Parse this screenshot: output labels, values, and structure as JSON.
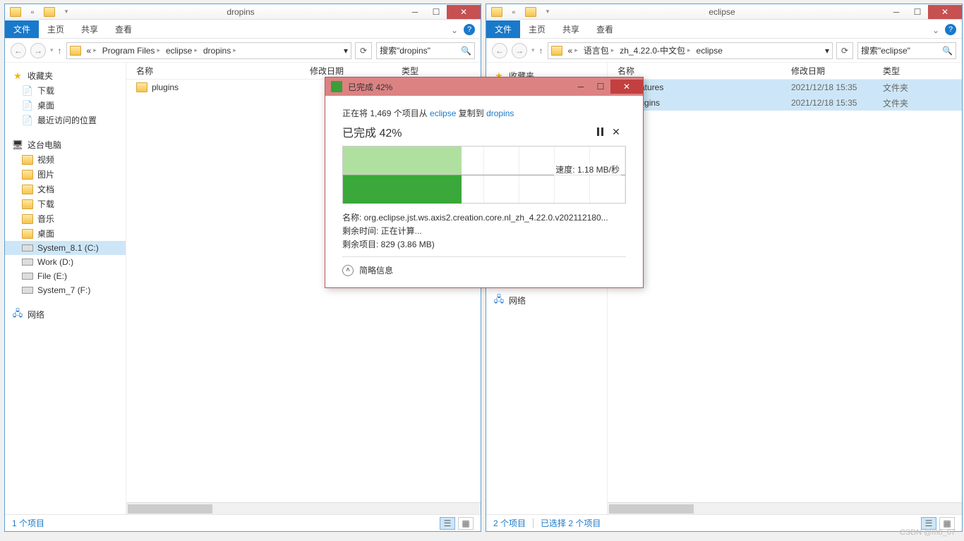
{
  "left": {
    "title": "dropins",
    "ribbon": {
      "file": "文件",
      "home": "主页",
      "share": "共享",
      "view": "查看"
    },
    "breadcrumbs": [
      "Program Files",
      "eclipse",
      "dropins"
    ],
    "search_placeholder": "搜索\"dropins\"",
    "columns": {
      "name": "名称",
      "date": "修改日期",
      "type": "类型"
    },
    "files": [
      {
        "name": "plugins",
        "date": "",
        "type": ""
      }
    ],
    "status": "1 个项目"
  },
  "right": {
    "title": "eclipse",
    "ribbon": {
      "file": "文件",
      "home": "主页",
      "share": "共享",
      "view": "查看"
    },
    "breadcrumbs": [
      "语言包",
      "zh_4.22.0-中文包",
      "eclipse"
    ],
    "search_placeholder": "搜索\"eclipse\"",
    "columns": {
      "name": "名称",
      "date": "修改日期",
      "type": "类型"
    },
    "files": [
      {
        "name": "features",
        "date": "2021/12/18 15:35",
        "type": "文件夹"
      },
      {
        "name": "plugins",
        "date": "2021/12/18 15:35",
        "type": "文件夹"
      }
    ],
    "status": "2 个项目",
    "status2": "已选择 2 个项目"
  },
  "nav": {
    "fav_header": "收藏夹",
    "fav": [
      "下载",
      "桌面",
      "最近访问的位置"
    ],
    "pc_header": "这台电脑",
    "pc_items": [
      "视频",
      "图片",
      "文档",
      "下载",
      "音乐",
      "桌面"
    ],
    "drives_left": [
      "System_8.1 (C:)",
      "Work (D:)",
      "File (E:)",
      "System_7 (F:)"
    ],
    "drives_right": [
      "Work (D:)",
      "File (E:)",
      "System_7 (F:)"
    ],
    "sel_left": "System_8.1 (C:)",
    "sel_right": "File (E:)",
    "network": "网络"
  },
  "dialog": {
    "title": "已完成 42%",
    "line1_pre": "正在将 1,469 个项目从 ",
    "line1_src": "eclipse",
    "line1_mid": " 复制到 ",
    "line1_dst": "dropins",
    "status": "已完成 42%",
    "percent": 42,
    "speed": "速度: 1.18 MB/秒",
    "name_lbl": "名称: ",
    "name_val": "org.eclipse.jst.ws.axis2.creation.core.nl_zh_4.22.0.v202112180...",
    "time_lbl": "剩余时间: ",
    "time_val": "正在计算...",
    "items_lbl": "剩余项目: ",
    "items_val": "829 (3.86 MB)",
    "footer": "简略信息"
  },
  "watermark": "CSDN @m0_67"
}
